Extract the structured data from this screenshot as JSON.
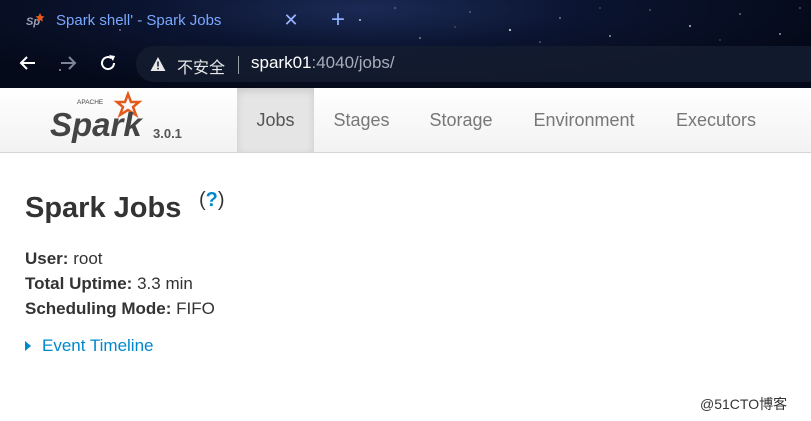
{
  "browser": {
    "tab_title": "Spark shell' - Spark Jobs",
    "tab_close": "✕",
    "new_tab": "+",
    "security_label": "不安全",
    "url_host": "spark01",
    "url_path": ":4040/jobs/"
  },
  "spark": {
    "logo_top": "APACHE",
    "logo_word": "Spark",
    "version": "3.0.1",
    "nav": [
      "Jobs",
      "Stages",
      "Storage",
      "Environment",
      "Executors"
    ],
    "active_nav": "Jobs"
  },
  "page": {
    "title": "Spark Jobs",
    "help_open": "(",
    "help_q": "?",
    "help_close": ")",
    "user_label": "User:",
    "user_value": "root",
    "uptime_label": "Total Uptime:",
    "uptime_value": "3.3 min",
    "mode_label": "Scheduling Mode:",
    "mode_value": "FIFO",
    "timeline_label": "Event Timeline"
  },
  "watermark": "@51CTO博客",
  "colors": {
    "link": "#0088cc",
    "spark_orange": "#e25a1c"
  }
}
